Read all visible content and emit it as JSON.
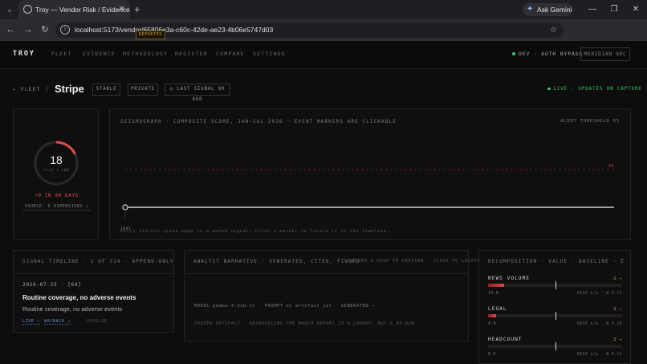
{
  "browser": {
    "tab_title": "Troy — Vendor Risk / Evidence",
    "ask_gemini": "Ask Gemini",
    "url": "localhost:5173/vendor/65806e3a-c60c-42de-ae23-4b06e5747d03"
  },
  "nav": {
    "brand": "TROY",
    "links": [
      "FLEET",
      "EVIDENCE",
      "METHODOLOGY",
      "REGISTER",
      "COMPARE",
      "SETTINGS"
    ],
    "env_status": "DEV · AUTH BYPASS",
    "user_button": "MERIDIAN GRC"
  },
  "vendor": {
    "back_label": "← FLEET",
    "separator": "/",
    "name": "Stripe",
    "tags": [
      "STABLE",
      "PRIVATE",
      "◷ LAST SIGNAL 80 AGO"
    ],
    "live_label": "LIVE · UPDATES ON CAPTURE"
  },
  "score": {
    "value": "18",
    "sub": "risk / 100",
    "progress": 0.18,
    "delta": "+0 IN 90 DAYS",
    "source": "SOURCE: 6 DIMENSIONS ↓"
  },
  "seismograph": {
    "title": "SEISMOGRAPH · COMPOSITE SCORE, JAN–JUL 2026 · EVENT MARKERS ARE CLICKABLE",
    "threshold_label": "ALERT THRESHOLD 65",
    "threshold_value": "65",
    "marker_label": "[64]",
    "footer": "Every visible spike maps to a dated signal. Click a marker to locate it in the timeline."
  },
  "chart_data": {
    "type": "line",
    "title": "SEISMOGRAPH · COMPOSITE SCORE, JAN–JUL 2026 · EVENT MARKERS ARE CLICKABLE",
    "threshold": 65,
    "ylim": [
      0,
      100
    ],
    "series": [
      {
        "values": [
          18,
          18
        ]
      }
    ],
    "markers": [
      {
        "label": "[64]"
      }
    ]
  },
  "timeline": {
    "title": "SIGNAL TIMELINE · 1 OF 314 · APPEND-ONLY",
    "entry": {
      "date": "2026-07-25 · [64]",
      "badge": "REPORTED",
      "headline": "Routine coverage, no adverse events",
      "body": "Routine coverage, no adverse events",
      "link_live": "LIVE ↗",
      "link_wayback": "WAYBACK ↗",
      "similar": "SIMILAR"
    }
  },
  "narrative": {
    "title": "ANALYST NARRATIVE · GENERATED, CITED, PINNED",
    "hint": "HOVER A CHIP TO PREVIEW · CLICK TO LOCATE",
    "meta": "MODEL gemma-4-31b-it · PROMPT no artifact yet · GENERATED —",
    "footer": "FROZEN ARTIFACT · REPRODUCING THE MARCH REPORT IS A LOOKUP, NOT A RE-RUN"
  },
  "decomposition": {
    "title": "DECOMPOSITION · VALUE · BASELINE · Z",
    "rows": [
      {
        "label": "NEWS VOLUME",
        "z": "z —",
        "value": "14.0",
        "meta": "BASE n/a · W 0.22",
        "level": 0.12,
        "baseline": 0.5
      },
      {
        "label": "LEGAL",
        "z": "z —",
        "value": "4.0",
        "meta": "BASE n/a · W 0.18",
        "level": 0.06,
        "baseline": 0.5
      },
      {
        "label": "HEADCOUNT",
        "z": "z —",
        "value": "0.0",
        "meta": "BASE n/a · W 0.12",
        "level": 0.0,
        "baseline": 0.5
      }
    ]
  }
}
